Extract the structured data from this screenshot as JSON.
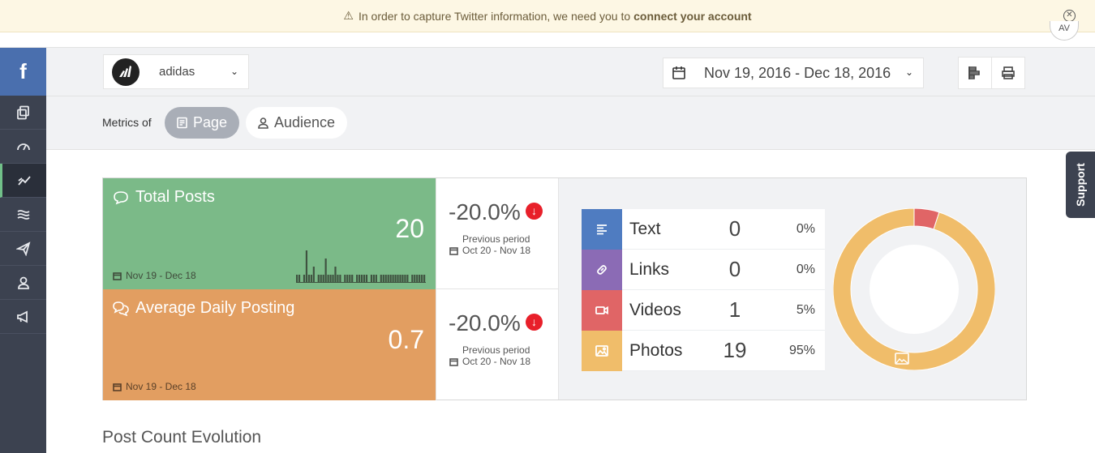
{
  "banner": {
    "message": "In order to capture Twitter information, we need you to",
    "link": "connect your account",
    "avatar_text": "AV"
  },
  "account": {
    "name": "adidas"
  },
  "date_range": "Nov 19, 2016 - Dec 18, 2016",
  "metrics": {
    "label": "Metrics of",
    "page_tab": "Page",
    "audience_tab": "Audience"
  },
  "support_label": "Support",
  "tiles": [
    {
      "title": "Total Posts",
      "value": "20",
      "range": "Nov 19 - Dec 18",
      "color": "#7bba88",
      "change": "-20.0%",
      "prev_label": "Previous period",
      "prev_range": "Oct 20 - Nov 18"
    },
    {
      "title": "Average Daily Posting",
      "value": "0.7",
      "range": "Nov 19 - Dec 18",
      "color": "#e29e61",
      "change": "-20.0%",
      "prev_label": "Previous period",
      "prev_range": "Oct 20 - Nov 18"
    }
  ],
  "sparkline_values": [
    1,
    1,
    0,
    1,
    4,
    1,
    1,
    2,
    0,
    1,
    1,
    1,
    3,
    1,
    1,
    1,
    2,
    1,
    1,
    0,
    1,
    1,
    1,
    1,
    0,
    1,
    1,
    1,
    1,
    1,
    0,
    1,
    1,
    1,
    0,
    1,
    1,
    1,
    1,
    1,
    1,
    1,
    1,
    1,
    1,
    1,
    1,
    0,
    1,
    1,
    1,
    1,
    1,
    1
  ],
  "post_types": [
    {
      "label": "Text",
      "count": "0",
      "pct": "0%",
      "color": "#4f7cc1",
      "icon": "align-left-icon"
    },
    {
      "label": "Links",
      "count": "0",
      "pct": "0%",
      "color": "#8b6bb5",
      "icon": "link-icon"
    },
    {
      "label": "Videos",
      "count": "1",
      "pct": "5%",
      "color": "#e06566",
      "icon": "video-icon"
    },
    {
      "label": "Photos",
      "count": "19",
      "pct": "95%",
      "color": "#f0bd6a",
      "icon": "image-icon"
    }
  ],
  "donut": {
    "videos_fraction": 0.05,
    "photos_fraction": 0.95
  },
  "section_title": "Post Count Evolution"
}
